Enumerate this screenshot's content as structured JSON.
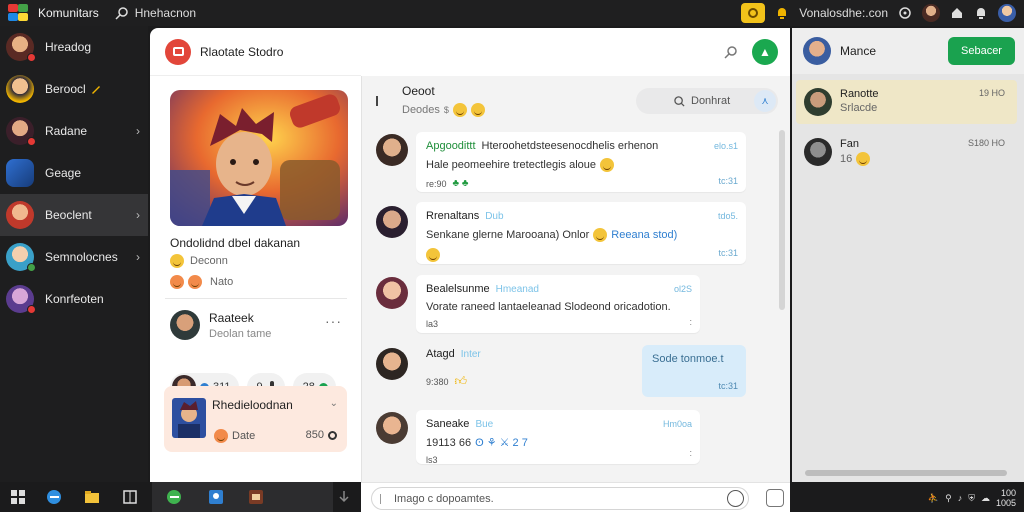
{
  "app": {
    "title": "Komunitars",
    "search_text": "Hnehacnon"
  },
  "topbar": {
    "user_label": "Vonalosdhe:.con"
  },
  "sidebar": {
    "items": [
      {
        "label": "Hreadog"
      },
      {
        "label": "Beroocl"
      },
      {
        "label": "Radane"
      },
      {
        "label": "Geage"
      },
      {
        "label": "Beoclent"
      },
      {
        "label": "Semnolocnes"
      },
      {
        "label": "Konrfeoten"
      }
    ]
  },
  "profile": {
    "header_title": "Rlaotate Stodro",
    "name": "Ondolidnd dbel dakanan",
    "status_text": "Deconn",
    "reactions_text": "Nato",
    "member": {
      "name": "Raateek",
      "sub": "Deolan tame"
    },
    "chips": [
      "311",
      "9",
      "28"
    ],
    "card": {
      "title": "Rhedieloodnan",
      "meta": "Date",
      "count": "850"
    }
  },
  "chat": {
    "thread_title": "Oeoot",
    "thread_sub": "Deodes",
    "search_placeholder": "Donhrat",
    "messages": [
      {
        "name": "Apgoodittt",
        "header_text": "Hteroohetdsteesenocdhelis erhenon",
        "tag": "",
        "time": "elo.s1",
        "text": "Hale peomeehire tretectlegis aloue",
        "foot": "re:90",
        "corner": "tc:31"
      },
      {
        "name": "Rrenaltans",
        "header_text": "",
        "tag": "Dub",
        "time": "tdo5.",
        "text": "Senkane glerne Marooana) Onlor",
        "text2": "Reeana stod)",
        "foot": "",
        "corner": "tc:31"
      },
      {
        "name": "Bealelsunme",
        "header_text": "",
        "tag": "Hmeanad",
        "time": "ol2S",
        "text": "Vorate raneed lantaeleanad Slodeond oricadotion.",
        "foot": "la3",
        "corner": ":"
      },
      {
        "name": "Atagd",
        "header_text": "",
        "tag": "Inter",
        "time": "",
        "text": "",
        "foot": "9:380",
        "corner": ""
      },
      {
        "name": "Saneake",
        "header_text": "",
        "tag": "Bue",
        "time": "Hm0oa",
        "text": "19113 66",
        "foot": "ls3",
        "corner": ":"
      }
    ],
    "own_message": {
      "text": "Sode tonmoe.t",
      "time": "tc:31"
    },
    "input_placeholder": "Imago c dopoamtes."
  },
  "right_panel": {
    "title": "Mance",
    "button_label": "Sebacer",
    "conversations": [
      {
        "name": "Ranotte",
        "sub": "Srlacde",
        "time": "19 HO"
      },
      {
        "name": "Fan",
        "sub": "16",
        "time": "S180 HO"
      }
    ]
  },
  "taskbar": {
    "clock_top": "100",
    "clock_bottom": "1005"
  },
  "colors": {
    "accent_green": "#1aa24f",
    "accent_red": "#e2463a",
    "selected_conv": "#efe7c7"
  }
}
